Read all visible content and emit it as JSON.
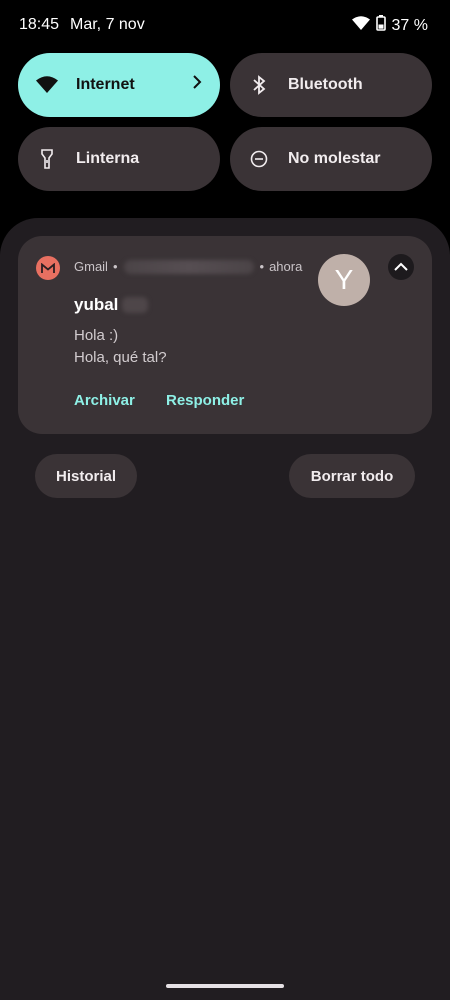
{
  "status": {
    "time": "18:45",
    "date": "Mar, 7 nov",
    "battery": "37 %"
  },
  "quick_settings": [
    {
      "label": "Internet",
      "state": "on",
      "icon": "wifi-icon"
    },
    {
      "label": "Bluetooth",
      "state": "off",
      "icon": "bluetooth-icon"
    },
    {
      "label": "Linterna",
      "state": "off",
      "icon": "flashlight-icon"
    },
    {
      "label": "No molestar",
      "state": "off",
      "icon": "do-not-disturb-icon"
    }
  ],
  "notification": {
    "app": "Gmail",
    "separator": "•",
    "time": "ahora",
    "avatar_letter": "Y",
    "sender": "yubal",
    "lines": [
      "Hola :)",
      "Hola, qué tal?"
    ],
    "actions": [
      "Archivar",
      "Responder"
    ]
  },
  "buttons": {
    "history": "Historial",
    "clear_all": "Borrar todo"
  },
  "colors": {
    "accent": "#8ef0e6",
    "tile_off": "#3a3336",
    "shade": "#211d21",
    "gmail_red": "#e87061"
  }
}
